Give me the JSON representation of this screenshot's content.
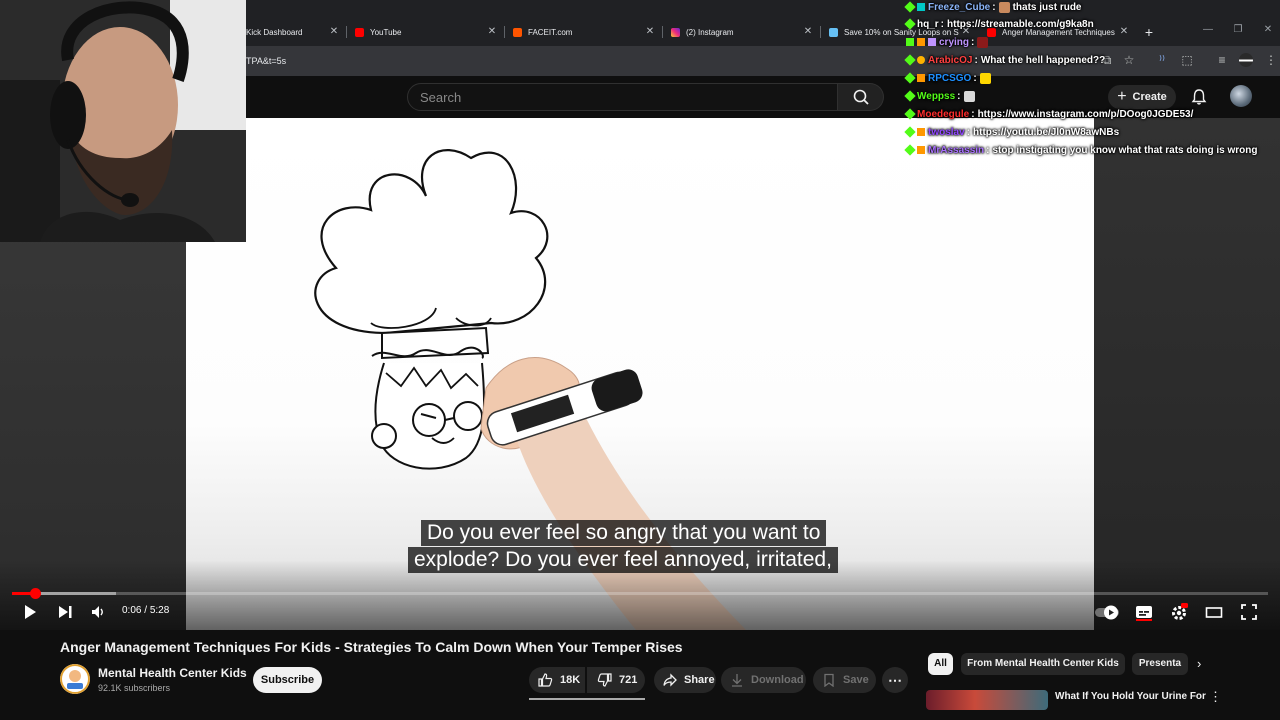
{
  "browser": {
    "tabs": [
      {
        "label": "Kick Dashboard",
        "favicon_color": "#53fc18"
      },
      {
        "label": "YouTube",
        "favicon_color": "#ff0000"
      },
      {
        "label": "FACEIT.com",
        "favicon_color": "#ff5500"
      },
      {
        "label": "(2) Instagram",
        "favicon_color": "#d6249f"
      },
      {
        "label": "Save 10% on Sanity Loops on S",
        "favicon_color": "#1b2838"
      },
      {
        "label": "Anger Management Techniques",
        "favicon_color": "#ff0000"
      }
    ],
    "url_fragment": "TPA&t=5s"
  },
  "youtube_header": {
    "search_placeholder": "Search",
    "create_label": "Create"
  },
  "player": {
    "caption_line1": "Do you ever feel so angry that you want to",
    "caption_line2": "explode? Do you ever feel annoyed, irritated,",
    "time_current": "0:06",
    "time_separator": " / ",
    "time_total": "5:28",
    "progress_fraction": 0.018,
    "buffered_fraction": 0.083
  },
  "video_info": {
    "title": "Anger Management Techniques For Kids - Strategies To Calm Down When Your Temper Rises",
    "channel_name": "Mental Health Center Kids",
    "subscribers": "92.1K subscribers",
    "subscribe_label": "Subscribe",
    "likes": "18K",
    "dislikes": "721",
    "share_label": "Share",
    "download_label": "Download",
    "save_label": "Save"
  },
  "recommendations": {
    "chips": [
      "All",
      "From Mental Health Center Kids",
      "Presenta"
    ],
    "first_title": "What If You Hold Your Urine For"
  },
  "chat": [
    {
      "user": "Freeze_Cube",
      "user_color": "#8ab4f8",
      "message": "thats just rude",
      "emote_color": "#c98a5e"
    },
    {
      "user": "hq_r",
      "user_color": "#ffffff",
      "message": "https://streamable.com/g9ka8n",
      "emote_color": ""
    },
    {
      "user": "crying",
      "user_color": "#bf94ff",
      "message": "",
      "emote_color": "#8b1a1a"
    },
    {
      "user": "ArabicOJ",
      "user_color": "#ff4040",
      "message": "What the hell happened??",
      "emote_color": ""
    },
    {
      "user": "RPCSGO",
      "user_color": "#1e90ff",
      "message": "",
      "emote_color": "#ffd700"
    },
    {
      "user": "Weppss",
      "user_color": "#53fc18",
      "message": "",
      "emote_color": "#d9d9d9"
    },
    {
      "user": "Moedegule",
      "user_color": "#ff2d2d",
      "message": "https://www.instagram.com/p/DOog0JGDE53/",
      "emote_color": ""
    },
    {
      "user": "twoslav",
      "user_color": "#9147ff",
      "message": "https://youtu.be/Jl0nW8awNBs",
      "emote_color": ""
    },
    {
      "user": "MrAssassin",
      "user_color": "#a970ff",
      "message": "stop instigating you know what that rats doing is wrong",
      "emote_color": ""
    }
  ],
  "colors": {
    "yt_red": "#ff0000",
    "background": "#0f0f0f",
    "kick_green": "#53fc18"
  },
  "icons": [
    "play-icon",
    "next-icon",
    "volume-icon",
    "autoplay-toggle-icon",
    "subtitles-icon",
    "settings-icon",
    "theater-icon",
    "fullscreen-icon",
    "search-icon",
    "bell-icon",
    "like-icon",
    "dislike-icon",
    "share-icon",
    "download-icon",
    "save-icon",
    "more-icon"
  ]
}
